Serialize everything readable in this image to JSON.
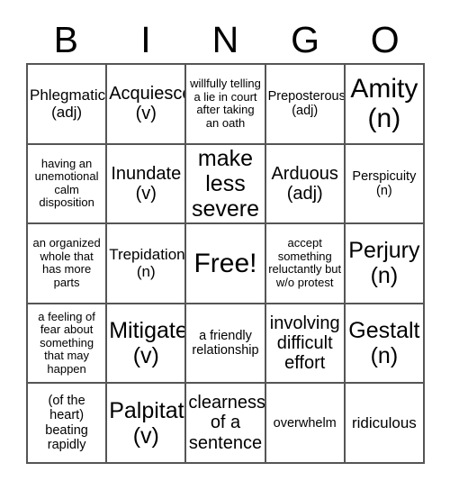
{
  "card": {
    "title_letters": [
      "B",
      "I",
      "N",
      "G",
      "O"
    ],
    "rows": [
      [
        {
          "text": "Phlegmatic\n(adj)",
          "size": "md"
        },
        {
          "text": "Acquiesce\n(v)",
          "size": "lg"
        },
        {
          "text": "willfully telling a lie in court after taking an oath",
          "size": "xs"
        },
        {
          "text": "Preposterous\n(adj)",
          "size": "sm"
        },
        {
          "text": "Amity\n(n)",
          "size": "xxl"
        }
      ],
      [
        {
          "text": "having an unemotional calm disposition",
          "size": "xs"
        },
        {
          "text": "Inundate\n(v)",
          "size": "lg"
        },
        {
          "text": "make\nless\nsevere",
          "size": "xl"
        },
        {
          "text": "Arduous\n(adj)",
          "size": "lg"
        },
        {
          "text": "Perspicuity\n(n)",
          "size": "sm"
        }
      ],
      [
        {
          "text": "an organized whole that has more parts",
          "size": "xs"
        },
        {
          "text": "Trepidation\n(n)",
          "size": "md"
        },
        {
          "text": "Free!",
          "size": "xxl"
        },
        {
          "text": "accept something reluctantly but w/o protest",
          "size": "xs"
        },
        {
          "text": "Perjury\n(n)",
          "size": "xl"
        }
      ],
      [
        {
          "text": "a feeling of fear about something that may happen",
          "size": "xs"
        },
        {
          "text": "Mitigate\n(v)",
          "size": "xl"
        },
        {
          "text": "a friendly relationship",
          "size": "sm"
        },
        {
          "text": "involving difficult effort",
          "size": "lg"
        },
        {
          "text": "Gestalt\n(n)",
          "size": "xl"
        }
      ],
      [
        {
          "text": "(of the heart) beating rapidly",
          "size": "sm"
        },
        {
          "text": "Palpitate\n(v)",
          "size": "xl"
        },
        {
          "text": "clearness of a sentence",
          "size": "lg"
        },
        {
          "text": "overwhelm",
          "size": "sm"
        },
        {
          "text": "ridiculous",
          "size": "md"
        }
      ]
    ]
  },
  "colors": {
    "border": "#555555",
    "text": "#000000",
    "background": "#ffffff"
  }
}
